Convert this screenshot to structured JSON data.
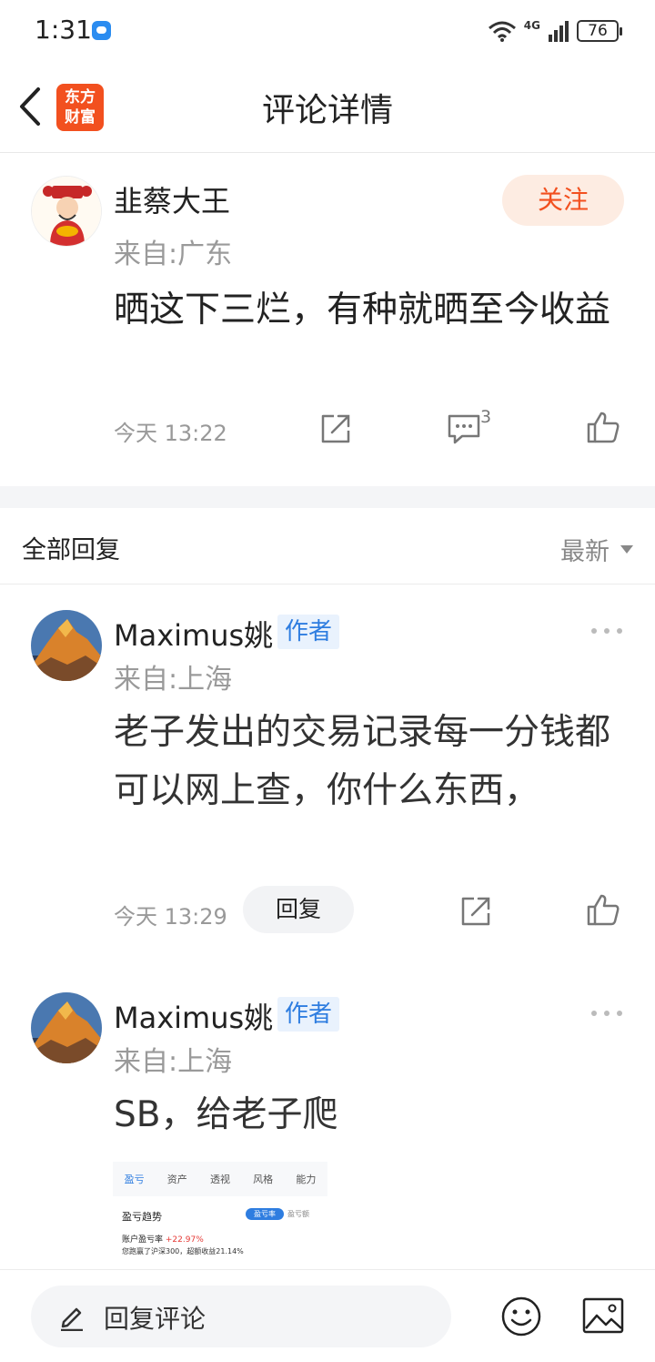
{
  "status_bar": {
    "time": "1:31",
    "network": "4G",
    "battery": "76",
    "icons": [
      "chat-notification-icon",
      "wifi-icon",
      "signal-icon",
      "battery-icon"
    ]
  },
  "header": {
    "title": "评论详情",
    "logo_line1": "东方",
    "logo_line2": "财富",
    "back_icon": "chevron-left-icon"
  },
  "main_comment": {
    "user_name": "韭蔡大王",
    "location": "来自:广东",
    "follow_label": "关注",
    "text": "晒这下三烂，有种就晒至今收益",
    "time": "今天 13:22",
    "reply_count": "3",
    "icons": [
      "share-icon",
      "comment-icon",
      "like-icon"
    ]
  },
  "replies_section": {
    "title": "全部回复",
    "sort_label": "最新"
  },
  "replies": [
    {
      "user_name": "Maximus姚",
      "badge": "作者",
      "location": "来自:上海",
      "text": "老子发出的交易记录每一分钱都可以网上查，你什么东西，",
      "time": "今天 13:29",
      "reply_label": "回复"
    },
    {
      "user_name": "Maximus姚",
      "badge": "作者",
      "location": "来自:上海",
      "text": "SB，给老子爬",
      "image": {
        "tabs": [
          "盈亏",
          "资产",
          "透视",
          "风格",
          "能力"
        ],
        "trend_label": "盈亏趋势",
        "pill_active": "盈亏率",
        "pill_inactive": "盈亏额",
        "rate_label": "账户盈亏率",
        "rate_value": "+22.97%",
        "summary": "您跑赢了沪深300，超额收益21.14%"
      }
    }
  ],
  "bottom_bar": {
    "input_placeholder": "回复评论",
    "icons": [
      "pencil-icon",
      "emoji-icon",
      "image-icon"
    ]
  },
  "colors": {
    "brand": "#f2501f",
    "badge_blue": "#2e7de0",
    "loss_red": "#e53935"
  }
}
